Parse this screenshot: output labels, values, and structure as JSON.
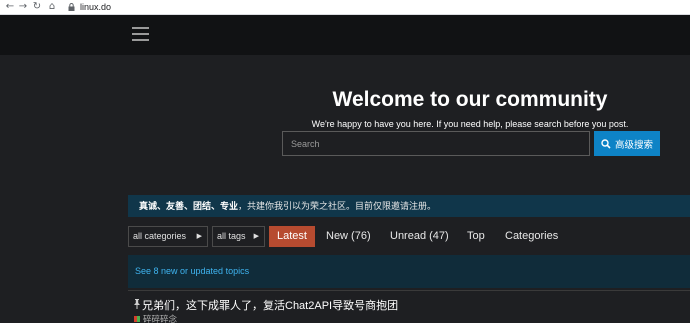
{
  "browser": {
    "url": "linux.do"
  },
  "hero": {
    "title": "Welcome to our community",
    "subtitle": "We're happy to have you here. If you need help, please search before you post.",
    "search_placeholder": "Search",
    "search_button_label": "高级搜索"
  },
  "banner": {
    "bold_text": "真诚、友善、团结、专业",
    "text": "，共建你我引以为荣之社区。目前仅限邀请注册。"
  },
  "filters": {
    "categories_label": "all categories",
    "tags_label": "all tags"
  },
  "nav": {
    "items": [
      {
        "label": "Latest"
      },
      {
        "label": "New (76)"
      },
      {
        "label": "Unread (47)"
      },
      {
        "label": "Top"
      },
      {
        "label": "Categories"
      }
    ]
  },
  "notice": {
    "text": "See 8 new or updated topics"
  },
  "topic": {
    "title": "兄弟们，这下成罪人了，复活Chat2API导致号商抱团",
    "category": "碎碎碎念"
  },
  "colors": {
    "header_bg": "#111214",
    "page_bg": "#1e1f22",
    "accent_blue": "#0e83c6",
    "active_tab": "#b74b30",
    "banner_bg": "#10364a",
    "notice_bg": "#102c3a",
    "link_blue": "#3fb4f0"
  }
}
